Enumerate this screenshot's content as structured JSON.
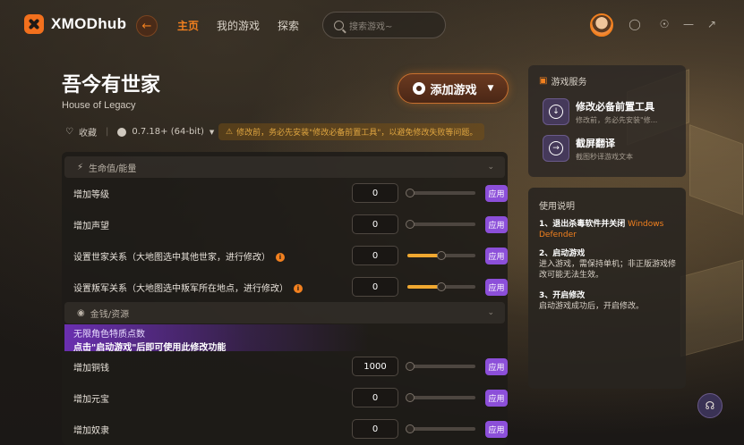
{
  "brand": {
    "name": "XMODhub"
  },
  "nav": {
    "home": "主页",
    "my_games": "我的游戏",
    "explore": "探索"
  },
  "search": {
    "placeholder": "搜索游戏~"
  },
  "game": {
    "title": "吾今有世家",
    "subtitle": "House of Legacy",
    "favorite_label": "收藏",
    "version": "0.7.18+ (64-bit)",
    "warning": "修改前，务必先安装\"修改必备前置工具\"，以避免修改失败等问题。",
    "add_button": "添加游戏"
  },
  "sections": [
    {
      "title": "生命值/能量"
    },
    {
      "title": "金钱/资源"
    }
  ],
  "rows": [
    {
      "label": "增加等级",
      "value": "0",
      "slider": 0.0,
      "apply": "应用",
      "info": false
    },
    {
      "label": "增加声望",
      "value": "0",
      "slider": 0.0,
      "apply": "应用",
      "info": false
    },
    {
      "label": "设置世家关系（大地图选中其他世家，进行修改）",
      "value": "0",
      "slider": 0.5,
      "apply": "应用",
      "info": true
    },
    {
      "label": "设置叛军关系（大地图选中叛军所在地点，进行修改）",
      "value": "0",
      "slider": 0.5,
      "apply": "应用",
      "info": true
    },
    {
      "label": "增加铜钱",
      "value": "1000",
      "slider": 0.0,
      "apply": "应用",
      "info": false
    },
    {
      "label": "增加元宝",
      "value": "0",
      "slider": 0.0,
      "apply": "应用",
      "info": false
    },
    {
      "label": "增加奴隶",
      "value": "0",
      "slider": 0.0,
      "apply": "应用",
      "info": false
    }
  ],
  "promo": {
    "line1": "无限角色特质点数",
    "line2": "点击\"启动游戏\"后即可使用此修改功能"
  },
  "services": {
    "title": "游戏服务",
    "items": [
      {
        "name": "修改必备前置工具",
        "desc": "修改前，务必先安装\"修..."
      },
      {
        "name": "截屏翻译",
        "desc": "截图秒译游戏文本"
      }
    ]
  },
  "guide": {
    "title": "使用说明",
    "steps": [
      {
        "head": "1、退出杀毒软件并关闭",
        "highlight": "Windows Defender",
        "body": ""
      },
      {
        "head": "2、启动游戏",
        "highlight": "",
        "body": "进入游戏，需保持单机；非正版游戏修改可能无法生效。"
      },
      {
        "head": "3、开启修改",
        "highlight": "",
        "body": "启动游戏成功后，开启修改。"
      }
    ]
  },
  "colors": {
    "accent": "#f2801f",
    "apply": "#8c4fd9",
    "slider_fill": "#f0a830"
  }
}
